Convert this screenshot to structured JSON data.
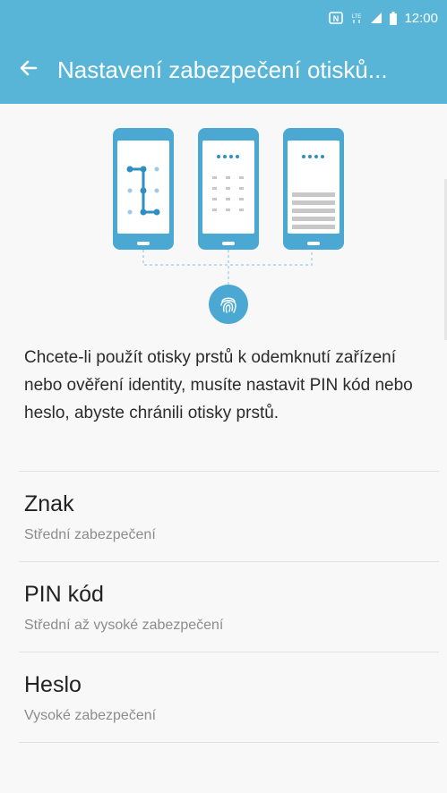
{
  "status_bar": {
    "time": "12:00",
    "icons": [
      "nfc-icon",
      "lte-icon",
      "signal-icon",
      "battery-icon"
    ]
  },
  "app_bar": {
    "back_icon": "arrow-left-icon",
    "title": "Nastavení zabezpečení otisků..."
  },
  "illustration": {
    "phones": [
      "pattern-screen",
      "pin-screen",
      "password-screen"
    ],
    "fingerprint_icon": "fingerprint-icon",
    "accent_color": "#4aa8d3"
  },
  "description": "Chcete-li použít otisky prstů k odemknutí zařízení nebo ověření identity, musíte nastavit PIN kód nebo heslo, abyste chránili otisky prstů.",
  "options": [
    {
      "title": "Znak",
      "subtitle": "Střední zabezpečení"
    },
    {
      "title": "PIN kód",
      "subtitle": "Střední až vysoké zabezpečení"
    },
    {
      "title": "Heslo",
      "subtitle": "Vysoké zabezpečení"
    }
  ],
  "colors": {
    "header": "#58b5d7",
    "background": "#f8f8f8"
  }
}
